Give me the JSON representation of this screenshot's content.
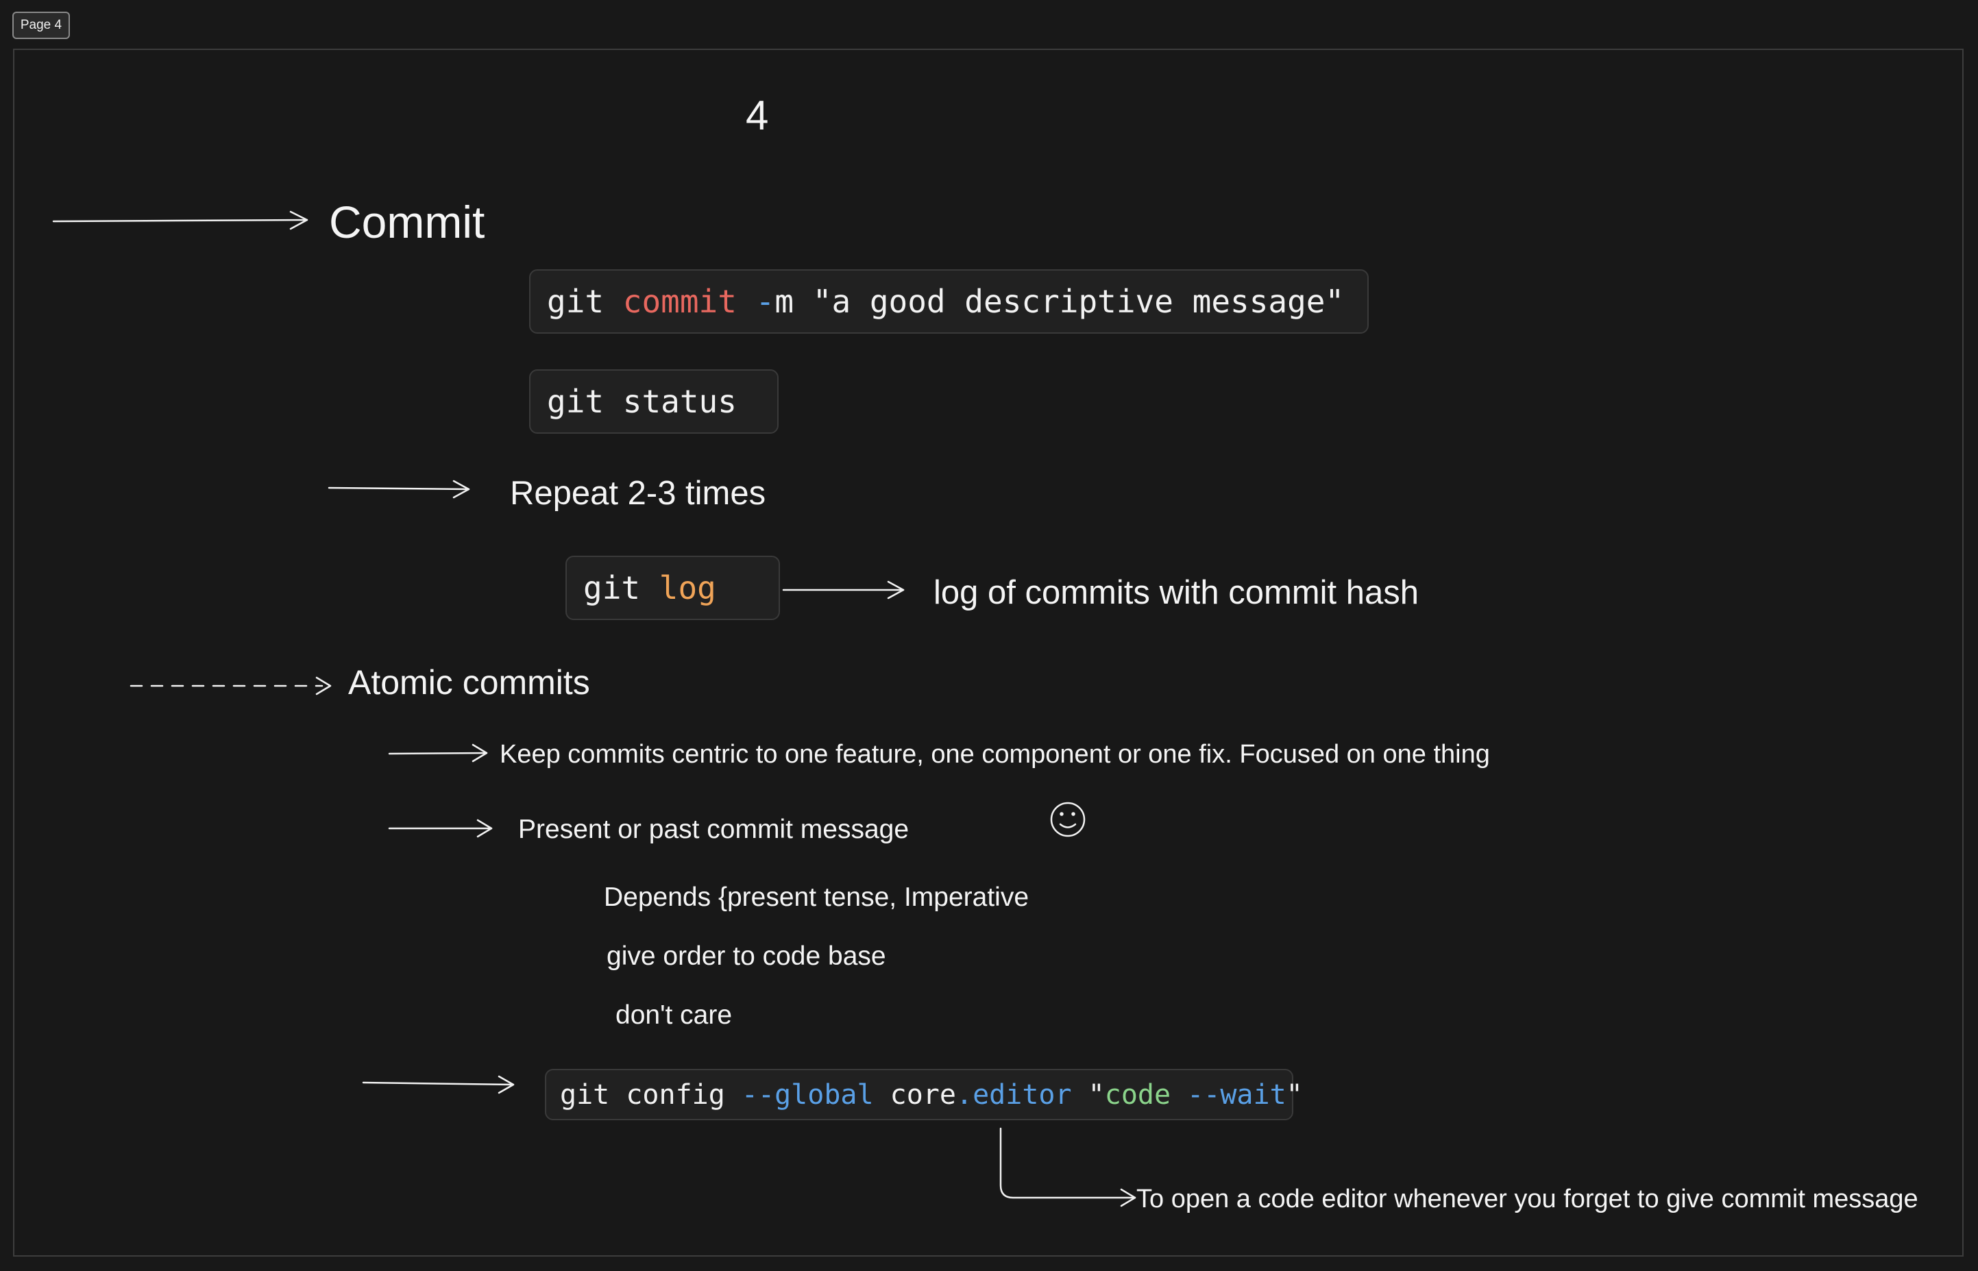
{
  "page_tab": "Page 4",
  "page_number": "4",
  "heading": "Commit",
  "code_commit": {
    "a": "git ",
    "b": "commit",
    "c": " ",
    "d": "-",
    "e": "m \"a good descriptive message\""
  },
  "code_status": "git status",
  "repeat_note": "Repeat  2-3 times",
  "code_log": {
    "a": "git ",
    "b": "log"
  },
  "log_note": "log of commits with commit hash",
  "atomic_heading": "Atomic commits",
  "atomic_point_1": "Keep commits centric to one feature, one component or one fix. Focused on one thing",
  "atomic_point_2": "Present or past commit message",
  "depends_line": "Depends {present tense, Imperative",
  "order_line": "give order to code base",
  "dont_care_line": "don't care",
  "code_config": {
    "a": "git config ",
    "b": "--global",
    "c": " core",
    "d": ".editor",
    "e": " \"",
    "f": "code",
    "g": " ",
    "h": "--wait",
    "i": "\""
  },
  "config_note": "To open a code editor whenever you forget to give commit message",
  "colors": {
    "background": "#181818",
    "keyword_red": "#e8685f",
    "flag_blue": "#5aa0e6",
    "keyword_orange": "#f0a458",
    "string_green": "#8bd48b"
  }
}
